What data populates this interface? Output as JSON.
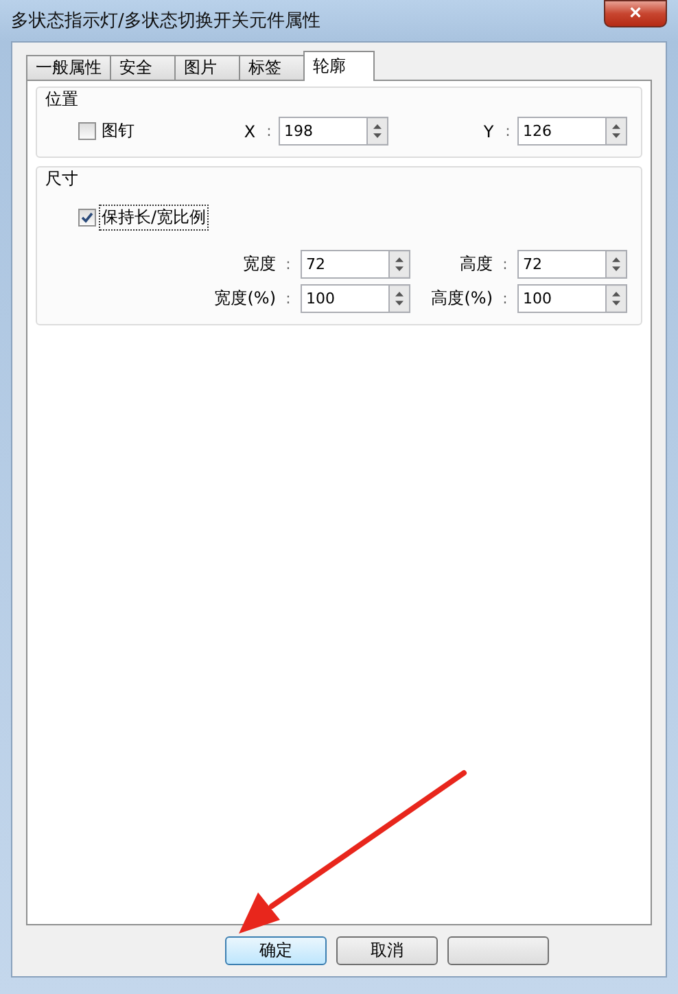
{
  "window": {
    "title": "多状态指示灯/多状态切换开关元件属性",
    "close": "×"
  },
  "tabs": [
    {
      "label": "一般属性",
      "selected": false
    },
    {
      "label": "安全",
      "selected": false
    },
    {
      "label": "图片",
      "selected": false
    },
    {
      "label": "标签",
      "selected": false
    },
    {
      "label": "轮廓",
      "selected": true
    }
  ],
  "position": {
    "title": "位置",
    "pin": {
      "label": "图钉",
      "checked": false
    },
    "fields": [
      {
        "label": "X",
        "colon": ":",
        "value": "198"
      },
      {
        "label": "Y",
        "colon": ":",
        "value": "126"
      }
    ]
  },
  "size": {
    "title": "尺寸",
    "keep_ratio": {
      "label": "保持长/宽比例",
      "checked": true
    },
    "fields": [
      {
        "label": "宽度",
        "colon": ":",
        "value": "72"
      },
      {
        "label": "高度",
        "colon": ":",
        "value": "72"
      },
      {
        "label": "宽度(%)",
        "colon": ":",
        "value": "100"
      },
      {
        "label": "高度(%)",
        "colon": ":",
        "value": "100"
      }
    ]
  },
  "buttons": [
    {
      "label": "确定",
      "selected": true
    },
    {
      "label": "取消",
      "selected": false
    },
    {
      "selected": false
    }
  ],
  "annotation": {
    "kind": "arrow"
  }
}
